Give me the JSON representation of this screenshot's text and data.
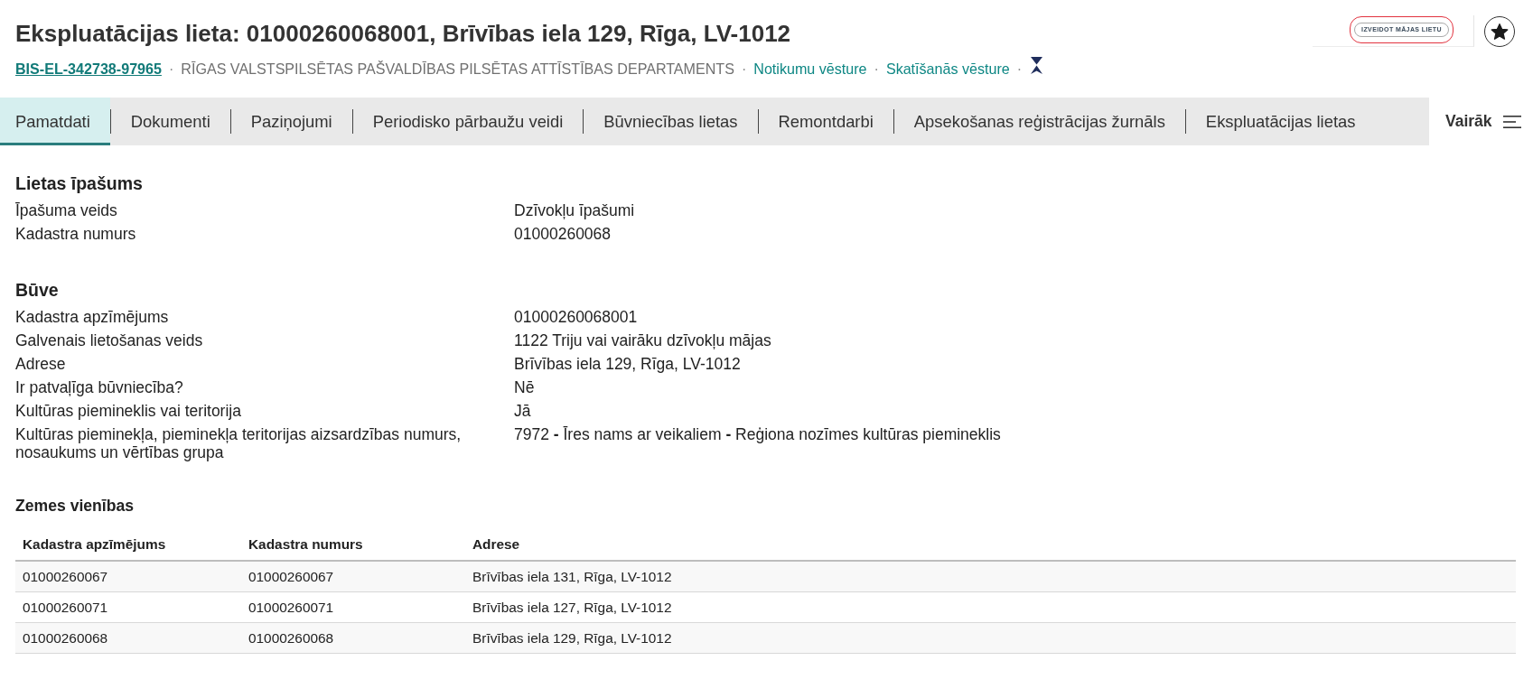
{
  "header": {
    "title": "Ekspluatācijas lieta: 01000260068001, Brīvības iela 129, Rīga, LV-1012",
    "meta": [
      {
        "kind": "id",
        "text": "BIS-EL-342738-97965"
      },
      {
        "kind": "separator",
        "text": "·"
      },
      {
        "kind": "org",
        "text": "RĪGAS VALSTSPILSĒTAS PAŠVALDĪBAS PILSĒTAS ATTĪSTĪBAS DEPARTAMENTS"
      },
      {
        "kind": "separator",
        "text": "·"
      },
      {
        "kind": "link",
        "text": "Notikumu vēsture"
      },
      {
        "kind": "separator",
        "text": "·"
      },
      {
        "kind": "link",
        "text": "Skatīšanās vēsture"
      },
      {
        "kind": "separator",
        "text": "·"
      }
    ],
    "create_button": {
      "label": "IZVEIDOT MĀJAS LIETU",
      "focused": true
    },
    "starred": true
  },
  "tabs": [
    {
      "label": "Pamatdati",
      "selected": true
    },
    {
      "label": "Dokumenti",
      "selected": false
    },
    {
      "label": "Paziņojumi",
      "selected": false
    },
    {
      "label": "Periodisko pārbaužu veidi",
      "selected": false
    },
    {
      "label": "Būvniecības lietas",
      "selected": false
    },
    {
      "label": "Remontdarbi",
      "selected": false
    },
    {
      "label": "Apsekošanas reģistrācijas žurnāls",
      "selected": false
    },
    {
      "label": "Ekspluatācijas lietas",
      "selected": false
    }
  ],
  "more_button": {
    "label": "Vairāk"
  },
  "sections": [
    {
      "title": "Lietas īpašums",
      "fields": [
        {
          "label": "Īpašuma veids",
          "value": "Dzīvokļu īpašumi"
        },
        {
          "label": "Kadastra numurs",
          "value": "01000260068"
        }
      ]
    },
    {
      "title": "Būve",
      "fields": [
        {
          "label": "Kadastra apzīmējums",
          "value": "01000260068001"
        },
        {
          "label": "Galvenais lietošanas veids",
          "value": "1122 Triju vai vairāku dzīvokļu mājas"
        },
        {
          "label": "Adrese",
          "value": "Brīvības iela 129, Rīga, LV-1012"
        },
        {
          "label": "Ir patvaļīga būvniecība?",
          "value": "Nē"
        },
        {
          "label": "Kultūras piemineklis vai teritorija",
          "value": "Jā"
        },
        {
          "label": "Kultūras pieminekļa, pieminekļa teritorijas aizsardzības numurs, nosaukums un vērtības grupa",
          "value": "7972 **-** Īres nams ar veikaliem **-** Reģiona nozīmes kultūras piemineklis"
        }
      ]
    }
  ],
  "land_units": {
    "title": "Zemes vienības",
    "columns": [
      "Kadastra apzīmējums",
      "Kadastra numurs",
      "Adrese"
    ],
    "rows": [
      [
        "01000260067",
        "01000260067",
        "Brīvības iela 131, Rīga, LV-1012"
      ],
      [
        "01000260071",
        "01000260071",
        "Brīvības iela 127, Rīga, LV-1012"
      ],
      [
        "01000260068",
        "01000260068",
        "Brīvības iela 129, Rīga, LV-1012"
      ]
    ]
  }
}
